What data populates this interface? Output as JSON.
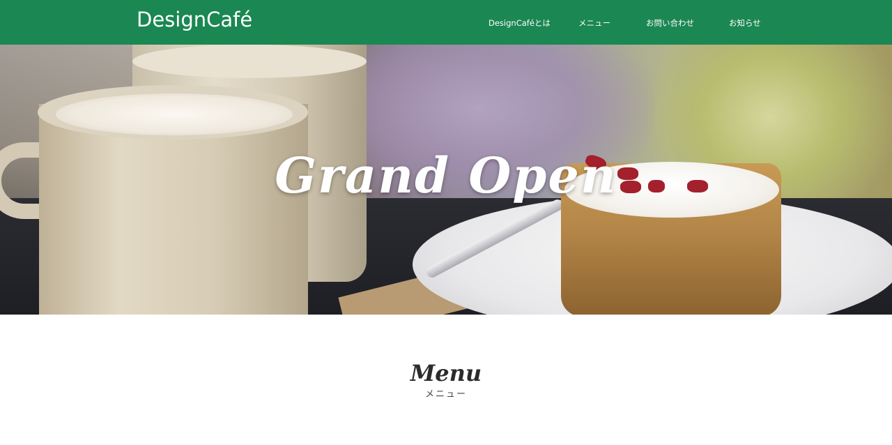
{
  "header": {
    "logo": "DesignCafé",
    "nav": [
      {
        "label": "DesignCaféとは"
      },
      {
        "label": "メニュー"
      },
      {
        "label": "お問い合わせ"
      },
      {
        "label": "お知らせ"
      }
    ]
  },
  "hero": {
    "title": "Grand Open"
  },
  "menu_section": {
    "title": "Menu",
    "subtitle": "メニュー"
  },
  "colors": {
    "header_bg": "#1b8752",
    "header_text": "#ffffff"
  }
}
